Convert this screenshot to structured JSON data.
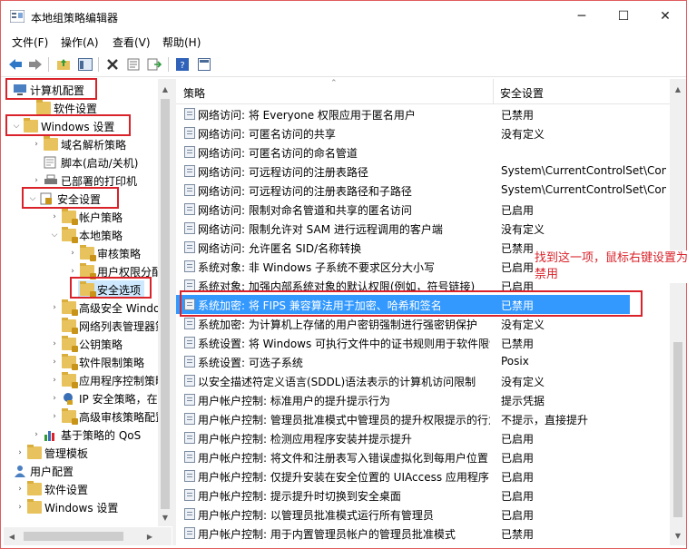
{
  "window": {
    "title": "本地组策略编辑器",
    "controls": {
      "minimize": "─",
      "maximize": "☐",
      "close": "✕"
    }
  },
  "menubar": [
    "文件(F)",
    "操作(A)",
    "查看(V)",
    "帮助(H)"
  ],
  "toolbar_icons": [
    "back-icon",
    "forward-icon",
    "up-folder-icon",
    "show-tree-icon",
    "delete-icon",
    "properties-icon",
    "export-icon",
    "help-icon",
    "view-icon"
  ],
  "tree": {
    "items": [
      {
        "label": "计算机配置"
      },
      {
        "label": "软件设置"
      },
      {
        "label": "Windows 设置"
      },
      {
        "label": "域名解析策略"
      },
      {
        "label": "脚本(启动/关机)"
      },
      {
        "label": "已部署的打印机"
      },
      {
        "label": "安全设置"
      },
      {
        "label": "帐户策略"
      },
      {
        "label": "本地策略"
      },
      {
        "label": "审核策略"
      },
      {
        "label": "用户权限分配"
      },
      {
        "label": "安全选项"
      },
      {
        "label": "高级安全 Windows Defender 防火墙"
      },
      {
        "label": "网络列表管理器策略"
      },
      {
        "label": "公钥策略"
      },
      {
        "label": "软件限制策略"
      },
      {
        "label": "应用程序控制策略"
      },
      {
        "label": "IP 安全策略，在本地计算机"
      },
      {
        "label": "高级审核策略配置"
      },
      {
        "label": "基于策略的 QoS"
      },
      {
        "label": "管理模板"
      },
      {
        "label": "用户配置"
      },
      {
        "label": "软件设置"
      },
      {
        "label": "Windows 设置"
      }
    ]
  },
  "list": {
    "headers": {
      "policy": "策略",
      "setting": "安全设置"
    },
    "rows": [
      {
        "policy": "网络访问: 将 Everyone 权限应用于匿名用户",
        "setting": "已禁用"
      },
      {
        "policy": "网络访问: 可匿名访问的共享",
        "setting": "没有定义"
      },
      {
        "policy": "网络访问: 可匿名访问的命名管道",
        "setting": ""
      },
      {
        "policy": "网络访问: 可远程访问的注册表路径",
        "setting": "System\\CurrentControlSet\\Control\\ProductOptions"
      },
      {
        "policy": "网络访问: 可远程访问的注册表路径和子路径",
        "setting": "System\\CurrentControlSet\\Control\\Print\\Printers"
      },
      {
        "policy": "网络访问: 限制对命名管道和共享的匿名访问",
        "setting": "已启用"
      },
      {
        "policy": "网络访问: 限制允许对 SAM 进行远程调用的客户端",
        "setting": "没有定义"
      },
      {
        "policy": "网络访问: 允许匿名 SID/名称转换",
        "setting": "已禁用"
      },
      {
        "policy": "系统对象: 非 Windows 子系统不要求区分大小写",
        "setting": "已启用"
      },
      {
        "policy": "系统对象: 加强内部系统对象的默认权限(例如，符号链接)",
        "setting": "已启用"
      },
      {
        "policy": "系统加密: 将 FIPS 兼容算法用于加密、哈希和签名",
        "setting": "已禁用"
      },
      {
        "policy": "系统加密: 为计算机上存储的用户密钥强制进行强密钥保护",
        "setting": "没有定义"
      },
      {
        "policy": "系统设置: 将 Windows 可执行文件中的证书规则用于软件限制策略",
        "setting": "已禁用"
      },
      {
        "policy": "系统设置: 可选子系统",
        "setting": "Posix"
      },
      {
        "policy": "以安全描述符定义语言(SDDL)语法表示的计算机访问限制",
        "setting": "没有定义"
      },
      {
        "policy": "用户帐户控制: 标准用户的提升提示行为",
        "setting": "提示凭据"
      },
      {
        "policy": "用户帐户控制: 管理员批准模式中管理员的提升权限提示的行为",
        "setting": "不提示，直接提升"
      },
      {
        "policy": "用户帐户控制: 检测应用程序安装并提示提升",
        "setting": "已启用"
      },
      {
        "policy": "用户帐户控制: 将文件和注册表写入错误虚拟化到每用户位置",
        "setting": "已启用"
      },
      {
        "policy": "用户帐户控制: 仅提升安装在安全位置的 UIAccess 应用程序",
        "setting": "已启用"
      },
      {
        "policy": "用户帐户控制: 提示提升时切换到安全桌面",
        "setting": "已启用"
      },
      {
        "policy": "用户帐户控制: 以管理员批准模式运行所有管理员",
        "setting": "已启用"
      },
      {
        "policy": "用户帐户控制: 用于内置管理员帐户的管理员批准模式",
        "setting": "已禁用"
      }
    ]
  },
  "annotation": {
    "text": "找到这一项，鼠标右键设置为禁用",
    "color": "#d9222a"
  },
  "colors": {
    "highlight": "#3399ff",
    "annotation_box": "#d9222a"
  }
}
